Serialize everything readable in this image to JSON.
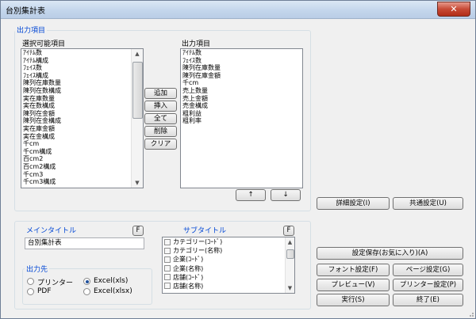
{
  "window": {
    "title": "台別集計表",
    "close_glyph": "✕"
  },
  "output_items": {
    "group_label": "出力項目",
    "available_label": "選択可能項目",
    "selected_label": "出力項目",
    "available": [
      "ｱｲﾃﾑ数",
      "ｱｲﾃﾑ構成",
      "ﾌｪｲｽ数",
      "ﾌｪｲｽ構成",
      "陳列在庫数量",
      "陳列在数構成",
      "実在庫数量",
      "実在数構成",
      "陳列在金額",
      "陳列在金構成",
      "実在庫金額",
      "実在金構成",
      "千cm",
      "千cm構成",
      "百cm2",
      "百cm2構成",
      "千cm3",
      "千cm3構成"
    ],
    "selected": [
      "ｱｲﾃﾑ数",
      "ﾌｪｲｽ数",
      "陳列在庫数量",
      "陳列在庫金額",
      "千cm",
      "売上数量",
      "売上金額",
      "売金構成",
      "粗利益",
      "粗利率"
    ],
    "buttons": {
      "add": "追加",
      "insert": "挿入",
      "all": "全て",
      "delete": "削除",
      "clear": "クリア"
    },
    "move_up": "↑",
    "move_down": "↓"
  },
  "right_buttons": {
    "detail": "詳細設定(I)",
    "common": "共通設定(U)",
    "save": "設定保存(お気に入り)(A)",
    "font": "フォント設定(F)",
    "page": "ページ設定(G)",
    "preview": "プレビュー(V)",
    "printer": "プリンター設定(P)",
    "run": "実行(S)",
    "end": "終了(E)"
  },
  "main_title": {
    "label": "メインタイトル",
    "f_button": "F",
    "value": "台別集計表"
  },
  "output_dest": {
    "label": "出力先",
    "options": [
      "プリンター",
      "Excel(xls)",
      "PDF",
      "Excel(xlsx)"
    ],
    "selected": "Excel(xls)"
  },
  "sub_title": {
    "label": "サブタイトル",
    "f_button": "F",
    "items": [
      "カテゴリー(ｺｰﾄﾞ)",
      "カテゴリー(名称)",
      "企業(ｺｰﾄﾞ)",
      "企業(名称)",
      "店舗(ｺｰﾄﾞ)",
      "店舗(名称)"
    ]
  },
  "colors": {
    "group_label": "#0046d5",
    "titlebar": "#c4d6ec",
    "close": "#c74a35"
  }
}
